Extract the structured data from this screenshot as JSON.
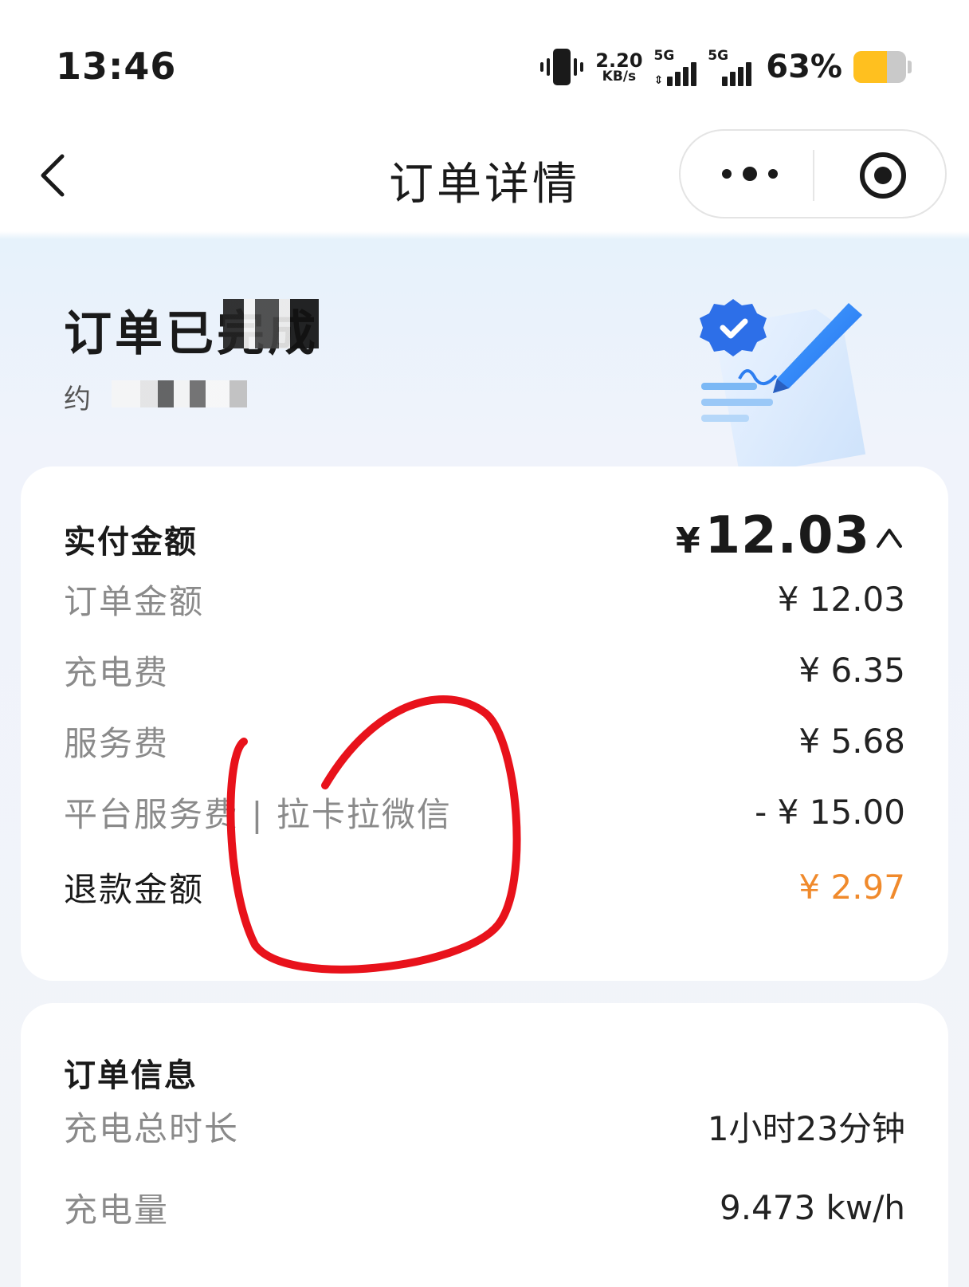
{
  "status_bar": {
    "time": "13:46",
    "speed_value": "2.20",
    "speed_unit": "KB/s",
    "sim1_tag": "5G",
    "sim2_tag": "5G",
    "battery_percent": "63%",
    "battery_level": 0.63,
    "battery_color": "#ffc01f"
  },
  "nav": {
    "title": "订单详情",
    "back_icon": "chevron-left-icon",
    "more_icon": "more-dots-icon",
    "close_icon": "target-circle-icon"
  },
  "hero": {
    "status_title": "订单已完成",
    "subtitle": "约"
  },
  "payment": {
    "heading": "实付金额",
    "total_currency": "¥",
    "total_amount": "12.03",
    "rows": [
      {
        "label": "订单金额",
        "value": "¥ 12.03"
      },
      {
        "label": "充电费",
        "value": "¥ 6.35"
      },
      {
        "label": "服务费",
        "value": "¥ 5.68"
      },
      {
        "label": "平台服务费 | 拉卡拉微信",
        "value": "- ¥ 15.00"
      }
    ],
    "refund": {
      "label": "退款金额",
      "value": "¥ 2.97",
      "color": "#f08a2c"
    }
  },
  "order_info": {
    "heading": "订单信息",
    "rows": [
      {
        "label": "充电总时长",
        "value": "1小时23分钟"
      },
      {
        "label": "充电量",
        "value": "9.473 kw/h"
      }
    ]
  },
  "annotation_color": "#e8121b"
}
